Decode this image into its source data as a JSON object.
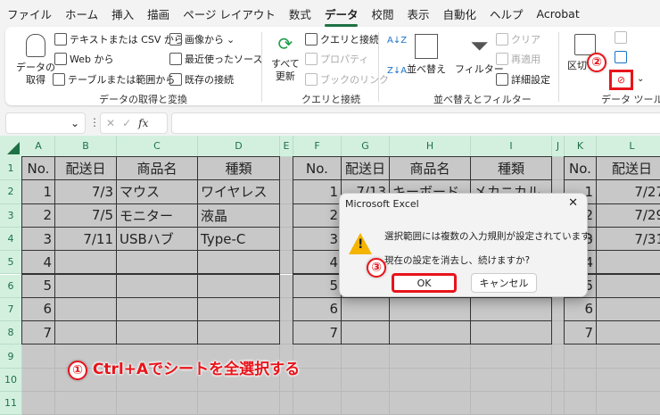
{
  "menu": {
    "tabs": [
      "ファイル",
      "ホーム",
      "挿入",
      "描画",
      "ページ レイアウト",
      "数式",
      "データ",
      "校閲",
      "表示",
      "自動化",
      "ヘルプ",
      "Acrobat"
    ],
    "active": "データ"
  },
  "ribbon": {
    "get_data": {
      "big": "データの\n取得",
      "items": [
        "テキストまたは CSV から",
        "Web から",
        "テーブルまたは範囲から",
        "画像から",
        "最近使ったソース",
        "既存の接続"
      ],
      "label": "データの取得と変換"
    },
    "queries": {
      "big": "すべて\n更新",
      "items": [
        "クエリと接続",
        "プロパティ",
        "ブックのリンク"
      ],
      "label": "クエリと接続"
    },
    "sort": {
      "sort": "並べ替え",
      "filter": "フィルター",
      "clear": "クリア",
      "reapply": "再適用",
      "advanced": "詳細設定",
      "label": "並べ替えとフィルター"
    },
    "tools": {
      "split": "区切り位置",
      "label": "データ ツール"
    }
  },
  "formula_bar": {
    "name_box": "",
    "fx": "fx"
  },
  "columns": [
    "A",
    "B",
    "C",
    "D",
    "E",
    "F",
    "G",
    "H",
    "I",
    "J",
    "K",
    "L"
  ],
  "rows": [
    "1",
    "2",
    "3",
    "4",
    "5",
    "6",
    "7",
    "8",
    "9",
    "10",
    "11"
  ],
  "headers": [
    "No.",
    "配送日",
    "商品名",
    "種類"
  ],
  "table1": [
    [
      "1",
      "7/3",
      "マウス",
      "ワイヤレス"
    ],
    [
      "2",
      "7/5",
      "モニター",
      "液晶"
    ],
    [
      "3",
      "7/11",
      "USBハブ",
      "Type-C"
    ],
    [
      "4",
      "",
      "",
      ""
    ],
    [
      "5",
      "",
      "",
      ""
    ],
    [
      "6",
      "",
      "",
      ""
    ],
    [
      "7",
      "",
      "",
      ""
    ]
  ],
  "table2": [
    [
      "1",
      "7/13",
      "キーボード",
      "メカニカル"
    ],
    [
      "2",
      "",
      "",
      ""
    ],
    [
      "3",
      "",
      "",
      ""
    ],
    [
      "4",
      "",
      "",
      ""
    ],
    [
      "5",
      "",
      "",
      ""
    ],
    [
      "6",
      "",
      "",
      ""
    ],
    [
      "7",
      "",
      "",
      ""
    ]
  ],
  "table3": [
    [
      "1",
      "7/27"
    ],
    [
      "2",
      "7/29"
    ],
    [
      "3",
      "7/31"
    ],
    [
      "4",
      ""
    ],
    [
      "5",
      ""
    ],
    [
      "6",
      ""
    ],
    [
      "7",
      ""
    ]
  ],
  "dialog": {
    "title": "Microsoft Excel",
    "message1": "選択範囲には複数の入力規則が設定されています。",
    "message2": "現在の設定を消去し、続けますか?",
    "ok": "OK",
    "cancel": "キャンセル"
  },
  "annotations": {
    "step1_num": "①",
    "step1": "Ctrl+Aでシートを全選択する",
    "step2_num": "②",
    "step3_num": "③"
  },
  "colors": {
    "accent": "#1e7145",
    "highlight": "#e8141b",
    "selection": "#c8c8c8"
  }
}
